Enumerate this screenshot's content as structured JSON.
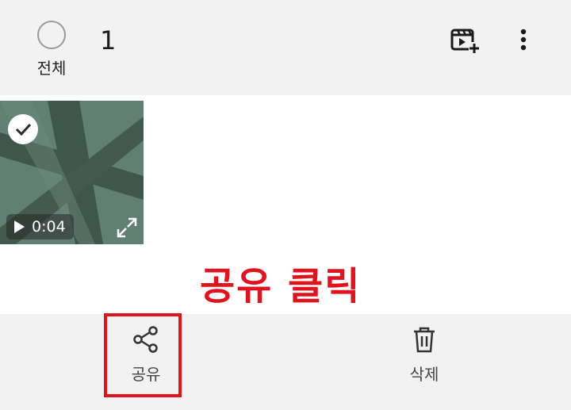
{
  "header": {
    "select_all_label": "전체",
    "selected_count": "1",
    "create_video_icon": "video-plus-icon",
    "more_icon": "more-vertical-icon"
  },
  "grid": {
    "items": [
      {
        "duration": "0:04",
        "selected": true,
        "type": "video"
      }
    ]
  },
  "annotation": {
    "text": "공유 클릭",
    "color": "#e0141e"
  },
  "bottom_bar": {
    "actions": [
      {
        "label": "공유",
        "icon": "share-icon",
        "highlighted": true
      },
      {
        "label": "삭제",
        "icon": "trash-icon",
        "highlighted": false
      }
    ]
  }
}
